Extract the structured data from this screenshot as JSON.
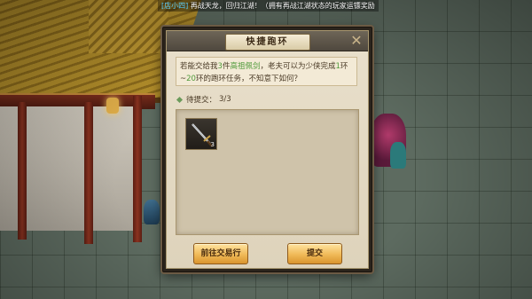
{
  "broadcast": {
    "channel": "[店小四]",
    "message": " 再战天龙，回归江湖！（拥有再战江湖状态的玩家运镖奖励"
  },
  "world": {
    "npc_tag_1": "",
    "npc_tag_2": ""
  },
  "dialog": {
    "title": "快捷跑环",
    "prompt_parts": {
      "p1": "若能交给我",
      "count": "3",
      "p2": "件",
      "item": "高祖佩剑",
      "p3": "，老夫可以为少侠完成",
      "r1": "1",
      "p4": "环~",
      "r2": "20",
      "p5": "环的跑环任务，不知意下如何？"
    },
    "pending_label": "待提交：",
    "pending_count": "3/3",
    "slot": {
      "icon": "sword-icon",
      "quantity": "3"
    },
    "buttons": {
      "trade": "前往交易行",
      "submit": "提交"
    }
  },
  "colors": {
    "accent_green": "#4f9a3a",
    "button_gold": "#f0b957",
    "channel_blue": "#5ad0ff"
  }
}
